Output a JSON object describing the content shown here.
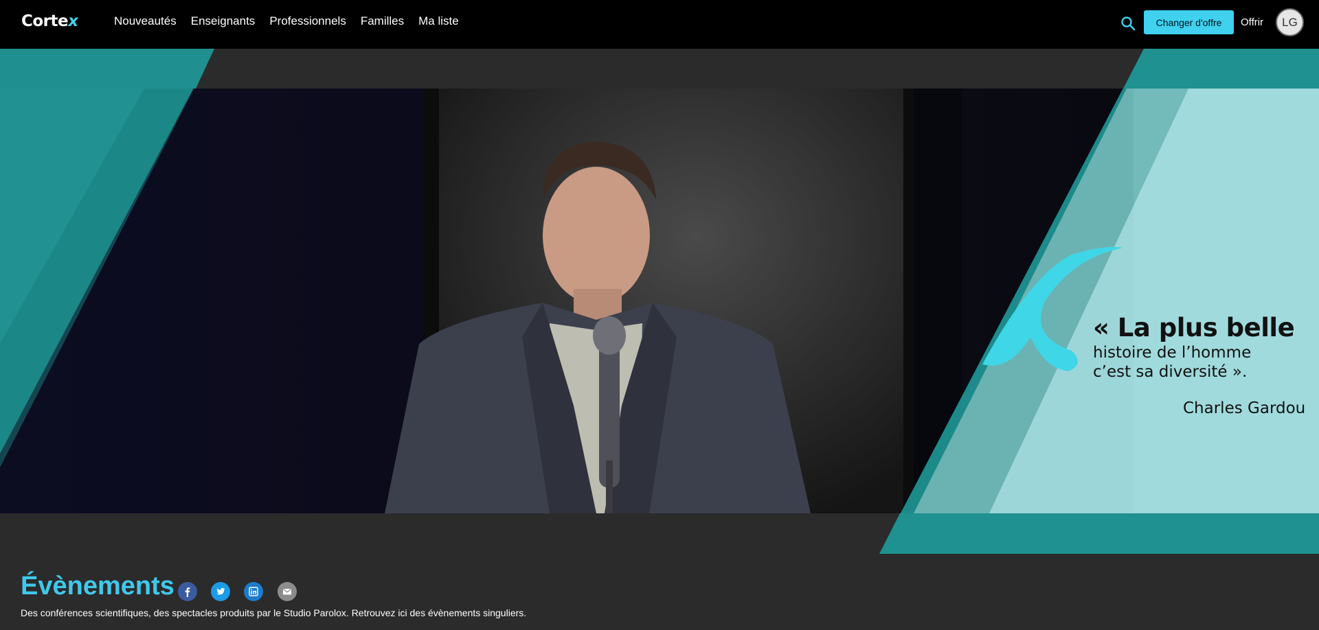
{
  "app": {
    "logo_main": "Corte",
    "logo_accent": "x"
  },
  "nav": {
    "items": [
      {
        "label": "Nouveautés"
      },
      {
        "label": "Enseignants"
      },
      {
        "label": "Professionnels"
      },
      {
        "label": "Familles"
      },
      {
        "label": "Ma liste"
      }
    ]
  },
  "header": {
    "search_icon": "search-icon",
    "offer_button": "Changer d'offre",
    "gift_link": "Offrir",
    "avatar_initials": "LG"
  },
  "hero": {
    "quote_line1": "« La plus belle",
    "quote_line2": "histoire de l’homme",
    "quote_line3": "c’est sa diversité ».",
    "quote_author": "Charles Gardou"
  },
  "events": {
    "title": "Évènements",
    "description": "Des conférences scientifiques, des spectacles produits par le Studio Parolox. Retrouvez ici des évènements singuliers.",
    "share_icons": [
      "facebook-icon",
      "twitter-icon",
      "linkedin-icon",
      "email-icon"
    ]
  },
  "colors": {
    "accent": "#3fd1ee",
    "teal": "#1f8f8f",
    "title": "#3fc9ec",
    "topbar": "#000000",
    "background": "#2b2b2b"
  }
}
